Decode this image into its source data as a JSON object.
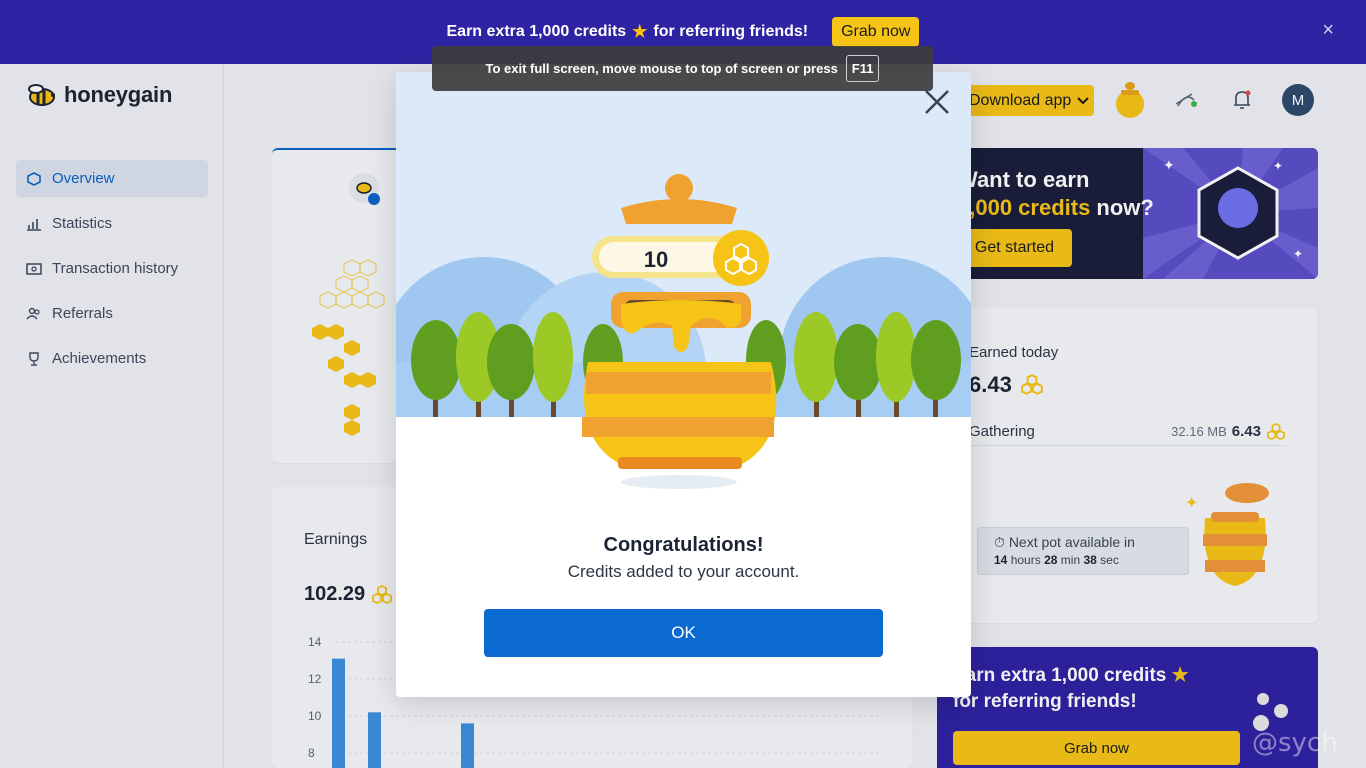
{
  "top_banner": {
    "text": "Earn extra 1,000 credits",
    "text_after": "for referring friends!",
    "star": "★",
    "button": "Grab now",
    "close": "×"
  },
  "fullscreen_toast": {
    "text": "To exit full screen, move mouse to top of screen or press",
    "key": "F11"
  },
  "logo": {
    "word": "honeygain"
  },
  "nav": {
    "items": [
      {
        "label": "Overview",
        "icon": "hexagon-icon",
        "active": true
      },
      {
        "label": "Statistics",
        "icon": "bar-chart-icon",
        "active": false
      },
      {
        "label": "Transaction history",
        "icon": "wallet-icon",
        "active": false
      },
      {
        "label": "Referrals",
        "icon": "people-icon",
        "active": false
      },
      {
        "label": "Achievements",
        "icon": "trophy-icon",
        "active": false
      }
    ]
  },
  "header": {
    "download_label": "Download app",
    "avatar_letter": "M"
  },
  "earnings": {
    "label": "Earnings",
    "value": "102.29",
    "chart_data": {
      "type": "bar",
      "y_ticks": [
        "14",
        "12",
        "10",
        "8"
      ],
      "ylim": [
        8,
        14
      ],
      "values": [
        13.1,
        10.2,
        9.6
      ]
    }
  },
  "promo": {
    "line1": "Want to earn",
    "gold": "1,000 credits",
    "line2_suffix": " now?",
    "button": "Get started"
  },
  "today": {
    "label": "Earned today",
    "value": "6.43",
    "row_label": "Gathering",
    "row_mb": "32.16 MB",
    "row_value": "6.43",
    "timer_title": "Next pot available in",
    "timer_hours": "14",
    "timer_hours_unit": "hours",
    "timer_min": "28",
    "timer_min_unit": "min",
    "timer_sec": "38",
    "timer_sec_unit": "sec"
  },
  "referral": {
    "line1": "Earn extra 1,000 credits",
    "line2": "for referring friends!",
    "star": "★",
    "button": "Grab now"
  },
  "modal": {
    "credits": "10",
    "title": "Congratulations!",
    "subtitle": "Credits added to your account.",
    "ok": "OK"
  },
  "watermark": "@sych",
  "colors": {
    "brand_blue": "#0b6ad1",
    "brand_yellow": "#f6c417",
    "banner_purple": "#2e23a2"
  }
}
